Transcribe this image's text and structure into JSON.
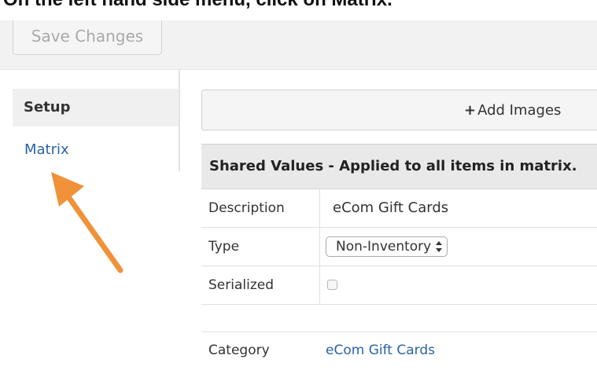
{
  "instruction": "On the left hand side menu, click on Matrix.",
  "toolbar": {
    "save_label": "Save Changes"
  },
  "sidebar": {
    "heading": "Setup",
    "items": [
      {
        "label": "Matrix",
        "color": "#2a62a6"
      }
    ]
  },
  "annotation": {
    "arrow_color": "#f0923a"
  },
  "images": {
    "add_label": "Add Images",
    "add_icon": "plus-icon"
  },
  "shared_values": {
    "header": "Shared Values - Applied to all items in matrix.",
    "fields": [
      {
        "label": "Description",
        "value": "eCom Gift Cards"
      },
      {
        "label": "Type",
        "value": "Non-Inventory"
      },
      {
        "label": "Serialized",
        "checked": false
      }
    ]
  },
  "category": {
    "label": "Category",
    "value": "eCom Gift Cards"
  }
}
